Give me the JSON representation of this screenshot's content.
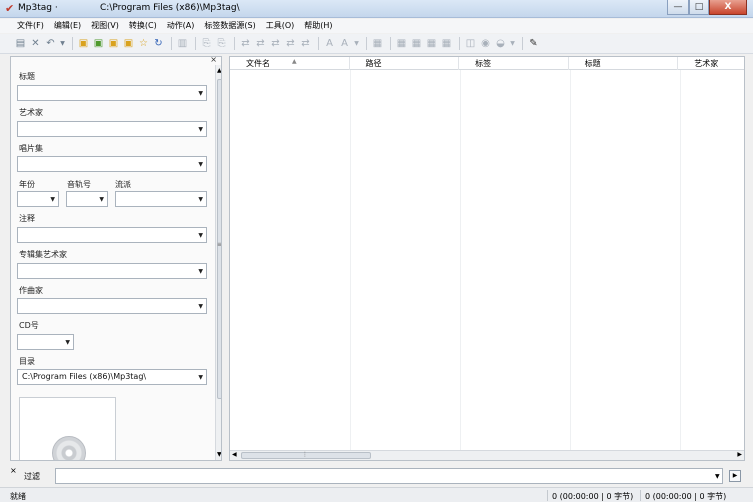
{
  "window": {
    "app_name": "Mp3tag",
    "app_name_suffix": "·",
    "path": "C:\\Program Files (x86)\\Mp3tag\\",
    "minimize": "—",
    "maximize": "□",
    "close": "X"
  },
  "menu": [
    "文件(F)",
    "编辑(E)",
    "视图(V)",
    "转换(C)",
    "动作(A)",
    "标签数据源(S)",
    "工具(O)",
    "帮助(H)"
  ],
  "tag_panel": {
    "close_glyph": "×",
    "title_label": "标题",
    "artist_label": "艺术家",
    "album_label": "唱片集",
    "year_label": "年份",
    "track_label": "音轨号",
    "genre_label": "流派",
    "comment_label": "注释",
    "album_artist_label": "专辑集艺术家",
    "composer_label": "作曲家",
    "disc_label": "CD号",
    "directory_label": "目录",
    "directory_value": "C:\\Program Files (x86)\\Mp3tag\\"
  },
  "file_list": {
    "columns": [
      "文件名",
      "路径",
      "标签",
      "标题",
      "艺术家"
    ]
  },
  "filter": {
    "label": "过滤",
    "handle": "×"
  },
  "status": {
    "left": "就绪",
    "selected": "0 (00:00:00 | 0 字节)",
    "total": "0 (00:00:00 | 0 字节)"
  }
}
